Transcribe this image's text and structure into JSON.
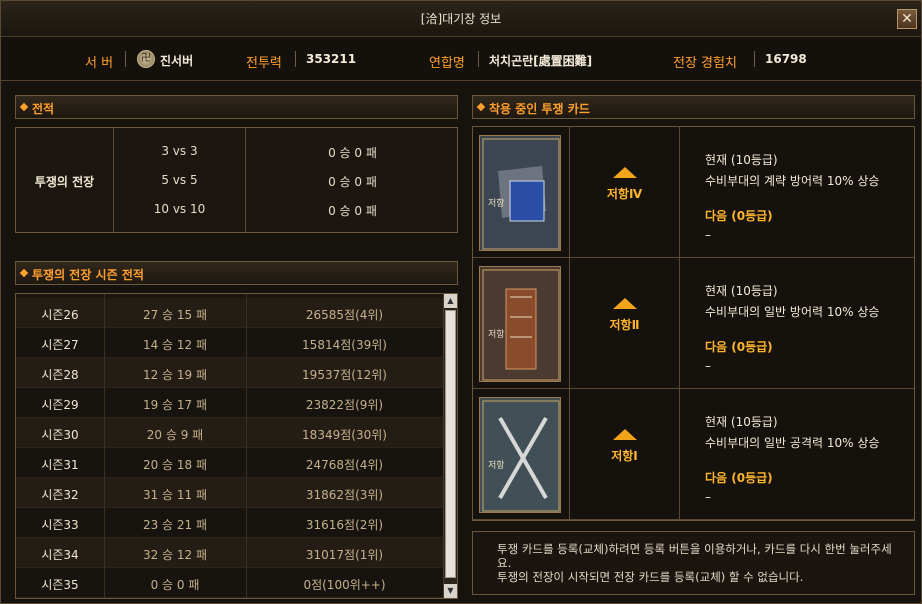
{
  "window": {
    "title": "[洽]대기장 정보",
    "close_icon": "close-icon"
  },
  "info": {
    "server_label": "서 버",
    "server_value": "진서버",
    "server_icon_glyph": "卍",
    "power_label": "전투력",
    "power_value": "353211",
    "alliance_label": "연합명",
    "alliance_value": "처치곤란[處置困難]",
    "exp_label": "전장 경험치",
    "exp_value": "16798"
  },
  "record": {
    "title": "전적",
    "category": "투쟁의 전장",
    "rows": [
      {
        "mode": "3 vs 3",
        "result": "0 승 0 패"
      },
      {
        "mode": "5 vs 5",
        "result": "0 승 0 패"
      },
      {
        "mode": "10 vs 10",
        "result": "0 승 0 패"
      }
    ]
  },
  "season": {
    "title": "투쟁의 전장 시즌 전적",
    "rows": [
      {
        "name": "시즌26",
        "wl": "27 승 15 패",
        "score": "26585점(4위)"
      },
      {
        "name": "시즌27",
        "wl": "14 승 12 패",
        "score": "15814점(39위)"
      },
      {
        "name": "시즌28",
        "wl": "12 승 19 패",
        "score": "19537점(12위)"
      },
      {
        "name": "시즌29",
        "wl": "19 승 17 패",
        "score": "23822점(9위)"
      },
      {
        "name": "시즌30",
        "wl": "20 승 9 패",
        "score": "18349점(30위)"
      },
      {
        "name": "시즌31",
        "wl": "20 승 18 패",
        "score": "24768점(4위)"
      },
      {
        "name": "시즌32",
        "wl": "31 승 11 패",
        "score": "31862점(3위)"
      },
      {
        "name": "시즌33",
        "wl": "23 승 21 패",
        "score": "31616점(2위)"
      },
      {
        "name": "시즌34",
        "wl": "32 승 12 패",
        "score": "31017점(1위)"
      },
      {
        "name": "시즌35",
        "wl": "0 승 0 패",
        "score": "0점(100위++)"
      }
    ]
  },
  "cards": {
    "title": "착용 중인 투쟁 카드",
    "items": [
      {
        "name": "저항Ⅳ",
        "cur_head": "현재 (10등급)",
        "cur_text": "수비부대의 계략 방어력 10% 상승",
        "next_head": "다음 (0등급)",
        "next_text": "–"
      },
      {
        "name": "저항Ⅱ",
        "cur_head": "현재 (10등급)",
        "cur_text": "수비부대의 일반 방어력 10% 상승",
        "next_head": "다음 (0등급)",
        "next_text": "–"
      },
      {
        "name": "저항Ⅰ",
        "cur_head": "현재 (10등급)",
        "cur_text": "수비부대의 일반 공격력 10% 상승",
        "next_head": "다음 (0등급)",
        "next_text": "–"
      }
    ]
  },
  "notice": {
    "line1": "투쟁 카드를 등록(교체)하려면 등록 버튼을 이용하거나, 카드를 다시 한번 눌러주세요.",
    "line2": "투쟁의 전장이 시작되면 전장 카드를 등록(교체) 할 수 없습니다."
  }
}
